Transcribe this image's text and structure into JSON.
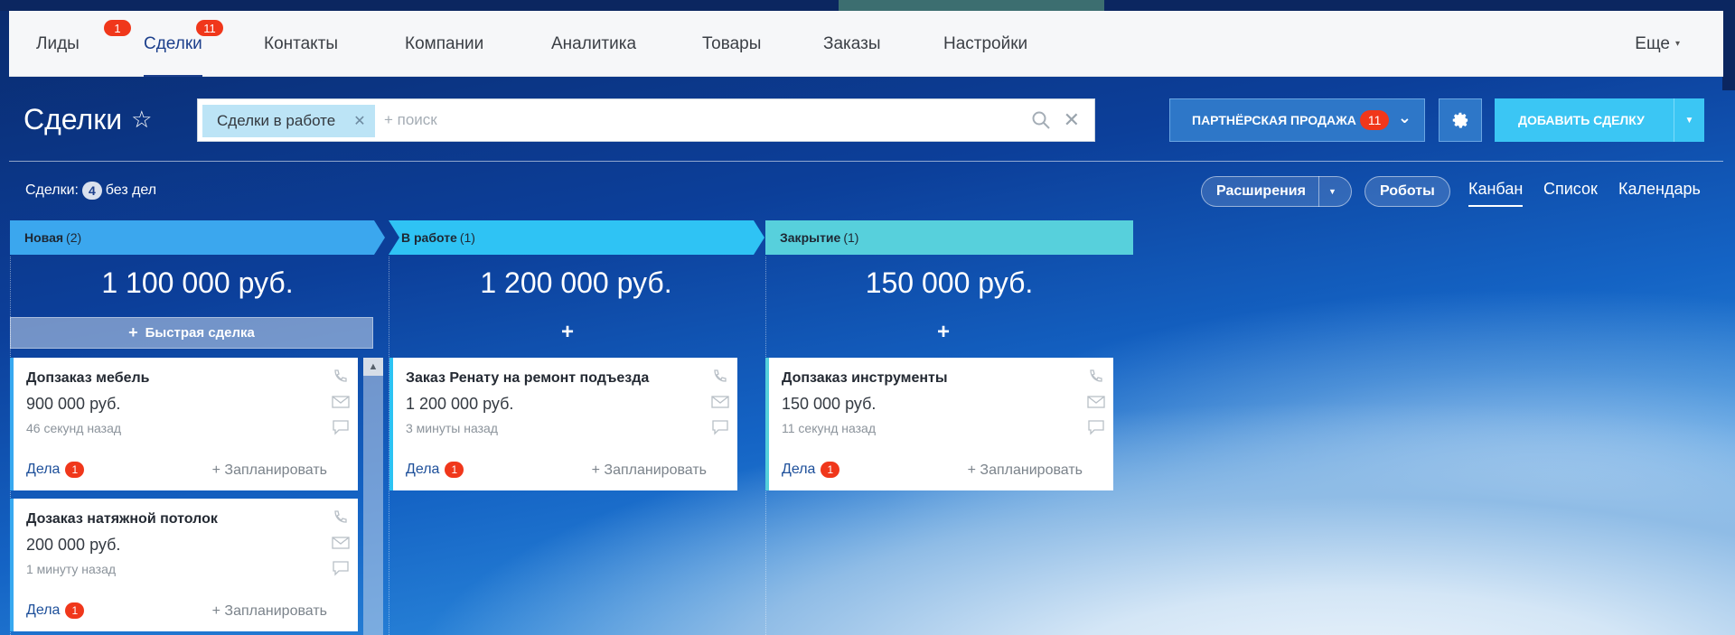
{
  "nav": {
    "items": [
      {
        "label": "Лиды",
        "badge": "1"
      },
      {
        "label": "Сделки",
        "badge": "11",
        "active": true
      },
      {
        "label": "Контакты"
      },
      {
        "label": "Компании"
      },
      {
        "label": "Аналитика"
      },
      {
        "label": "Товары"
      },
      {
        "label": "Заказы"
      },
      {
        "label": "Настройки"
      }
    ],
    "more_label": "Еще"
  },
  "header": {
    "title": "Сделки",
    "filter_chip": "Сделки в работе",
    "search_placeholder": "+ поиск",
    "partner_button": "ПАРТНЁРСКАЯ ПРОДАЖА",
    "partner_badge": "11",
    "add_button": "ДОБАВИТЬ СДЕЛКУ"
  },
  "toolbar": {
    "deals_label": "Сделки:",
    "deals_count": "4",
    "deals_suffix": "без дел",
    "extensions": "Расширения",
    "robots": "Роботы",
    "views": [
      "Канбан",
      "Список",
      "Календарь"
    ],
    "active_view": "Канбан"
  },
  "stages": [
    {
      "name": "Новая",
      "count": "(2)",
      "sum": "1 100 000 руб.",
      "color": "#3ba7ee"
    },
    {
      "name": "В работе",
      "count": "(1)",
      "sum": "1 200 000 руб.",
      "color": "#2fc3f4"
    },
    {
      "name": "Закрытие",
      "count": "(1)",
      "sum": "150 000 руб.",
      "color": "#57d0dc"
    }
  ],
  "quick_deal": "Быстрая сделка",
  "cards": [
    {
      "title": "Допзаказ мебель",
      "price": "900 000 руб.",
      "time": "46 секунд назад",
      "tasks": "Дела",
      "tasks_badge": "1",
      "plan": "+ Запланировать"
    },
    {
      "title": "Дозаказ натяжной потолок",
      "price": "200 000 руб.",
      "time": "1 минуту назад",
      "tasks": "Дела",
      "tasks_badge": "1",
      "plan": "+ Запланировать"
    },
    {
      "title": "Заказ Ренату на ремонт подъезда",
      "price": "1 200 000 руб.",
      "time": "3 минуты назад",
      "tasks": "Дела",
      "tasks_badge": "1",
      "plan": "+ Запланировать"
    },
    {
      "title": "Допзаказ инструменты",
      "price": "150 000 руб.",
      "time": "11 секунд назад",
      "tasks": "Дела",
      "tasks_badge": "1",
      "plan": "+ Запланировать"
    }
  ]
}
